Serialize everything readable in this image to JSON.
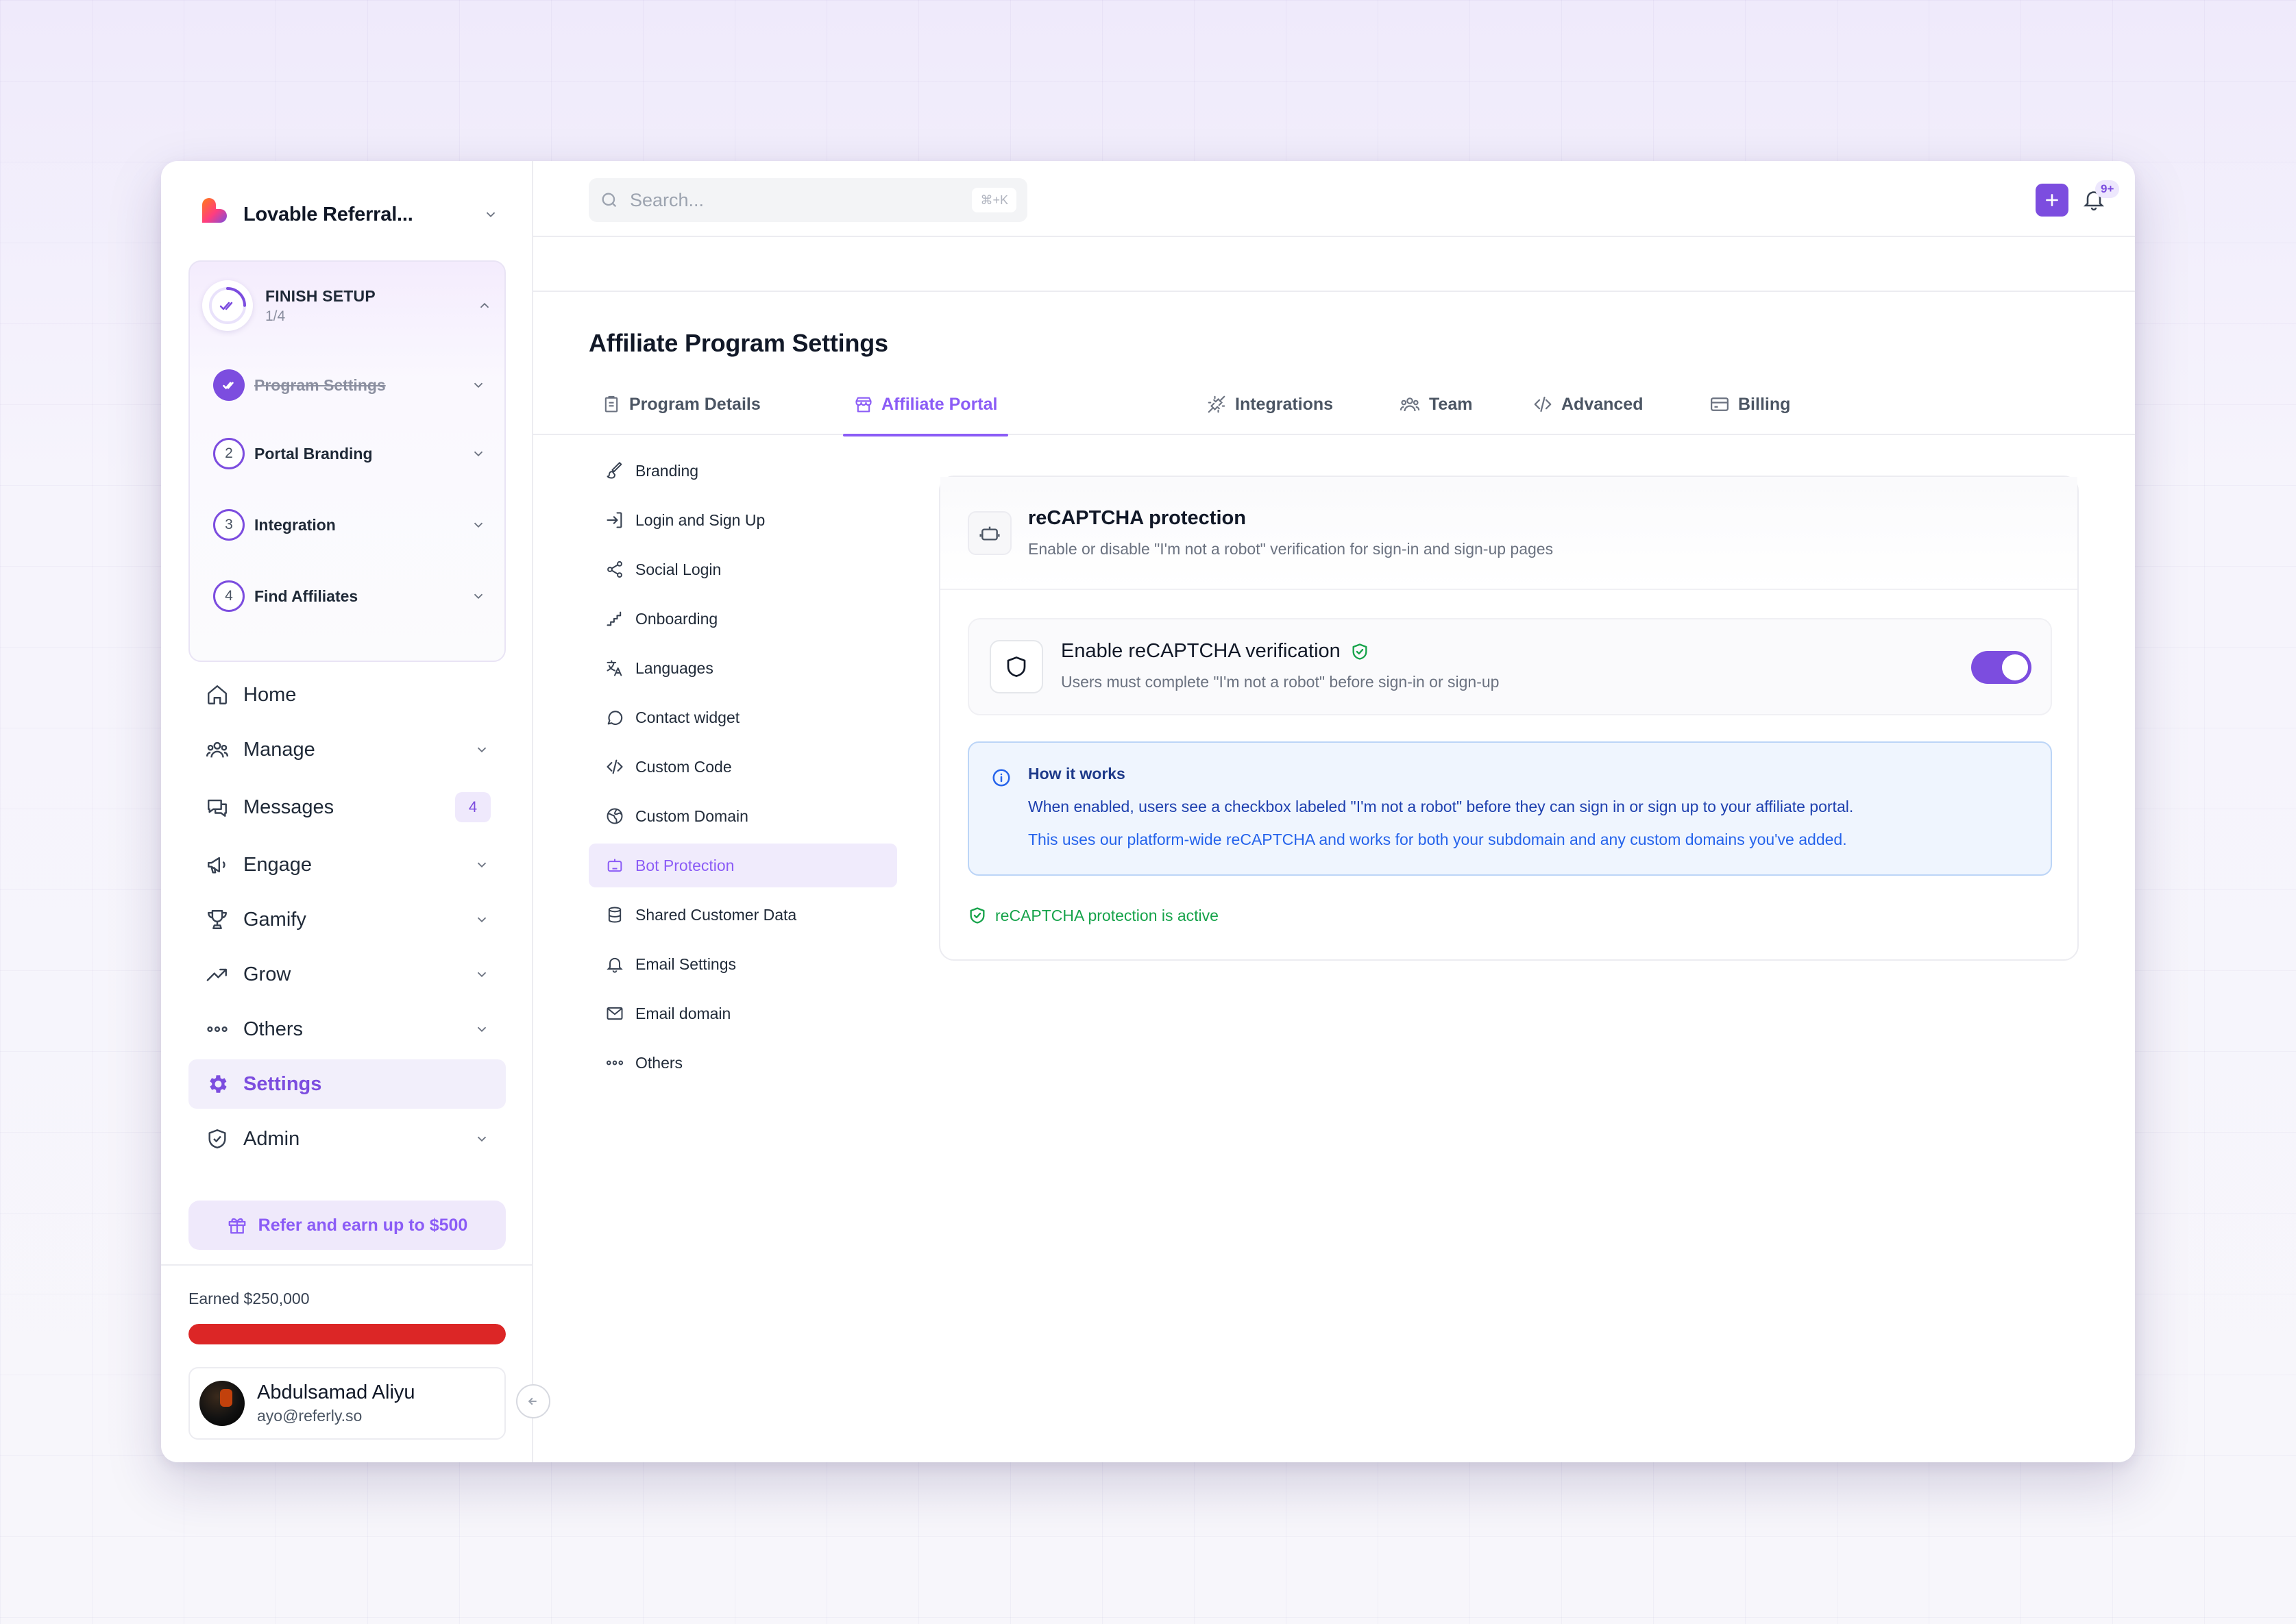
{
  "brand": {
    "name": "Lovable Referral..."
  },
  "setup": {
    "title": "FINISH SETUP",
    "count": "1/4",
    "steps": [
      {
        "num": "",
        "label": "Program Settings",
        "done": true
      },
      {
        "num": "2",
        "label": "Portal Branding"
      },
      {
        "num": "3",
        "label": "Integration"
      },
      {
        "num": "4",
        "label": "Find Affiliates"
      }
    ]
  },
  "nav": {
    "home": "Home",
    "manage": "Manage",
    "messages": "Messages",
    "messages_badge": "4",
    "engage": "Engage",
    "gamify": "Gamify",
    "grow": "Grow",
    "others": "Others",
    "settings": "Settings",
    "admin": "Admin"
  },
  "refer": {
    "label": "Refer and earn up to $500"
  },
  "earned": {
    "label": "Earned $250,000",
    "progress": 1.0
  },
  "user": {
    "name": "Abdulsamad Aliyu",
    "email": "ayo@referly.so"
  },
  "search": {
    "placeholder": "Search...",
    "shortcut": "⌘+K"
  },
  "notifications": {
    "badge": "9+"
  },
  "page": {
    "title": "Affiliate Program Settings"
  },
  "tabs": {
    "program_details": "Program Details",
    "affiliate_portal": "Affiliate Portal",
    "integrations": "Integrations",
    "team": "Team",
    "advanced": "Advanced",
    "billing": "Billing"
  },
  "subnav": {
    "branding": "Branding",
    "login": "Login and Sign Up",
    "social": "Social Login",
    "onboarding": "Onboarding",
    "languages": "Languages",
    "contact": "Contact widget",
    "code": "Custom Code",
    "domain": "Custom Domain",
    "bot": "Bot Protection",
    "shared": "Shared Customer Data",
    "email_settings": "Email Settings",
    "email_domain": "Email domain",
    "others": "Others"
  },
  "card": {
    "title": "reCAPTCHA protection",
    "subtitle": "Enable or disable \"I'm not a robot\" verification for sign-in and sign-up pages",
    "toggle_title": "Enable reCAPTCHA verification",
    "toggle_sub": "Users must complete \"I'm not a robot\" before sign-in or sign-up",
    "toggle_on": true,
    "info_title": "How it works",
    "info_line1": "When enabled, users see a checkbox labeled \"I'm not a robot\" before they can sign in or sign up to your affiliate portal.",
    "info_line2": "This uses our platform-wide reCAPTCHA and works for both your subdomain and any custom domains you've added.",
    "status": "reCAPTCHA protection is active"
  },
  "colors": {
    "accent": "#7c4ddf",
    "progress": "#dc2626",
    "success": "#16a34a",
    "info": "#2563eb"
  }
}
